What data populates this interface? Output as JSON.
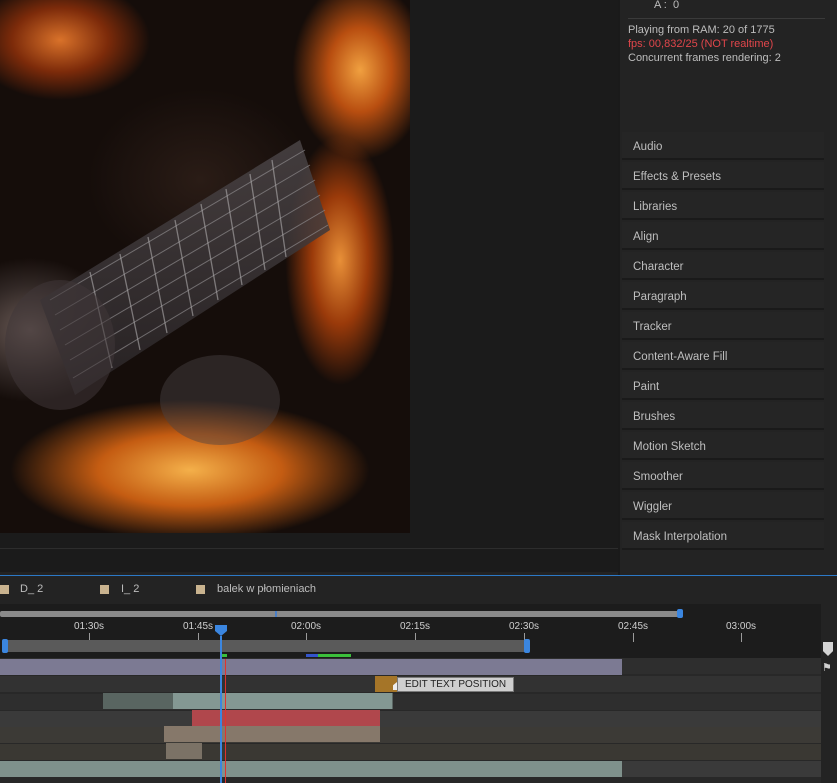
{
  "info": {
    "a_label": "A :",
    "a_value": "0",
    "ram_text": "Playing from RAM: 20 of 1775",
    "fps_text": "fps: 00,832/25 (NOT realtime)",
    "concurrent_text": "Concurrent frames rendering: 2",
    "fps_color": "#e0464b"
  },
  "panels": [
    "Audio",
    "Effects & Presets",
    "Libraries",
    "Align",
    "Character",
    "Paragraph",
    "Tracker",
    "Content-Aware Fill",
    "Paint",
    "Brushes",
    "Motion Sketch",
    "Smoother",
    "Wiggler",
    "Mask Interpolation"
  ],
  "timeline": {
    "tabs": [
      "D_ 2",
      "I_ 2",
      "balek w płomieniach"
    ],
    "ticks": [
      "01:30s",
      "01:45s",
      "02:00s",
      "02:15s",
      "02:30s",
      "02:45s",
      "03:00s"
    ],
    "marker_label": "EDIT TEXT POSITION",
    "playhead_color": "#3b86e0",
    "current_time_color": "#e0322f"
  }
}
